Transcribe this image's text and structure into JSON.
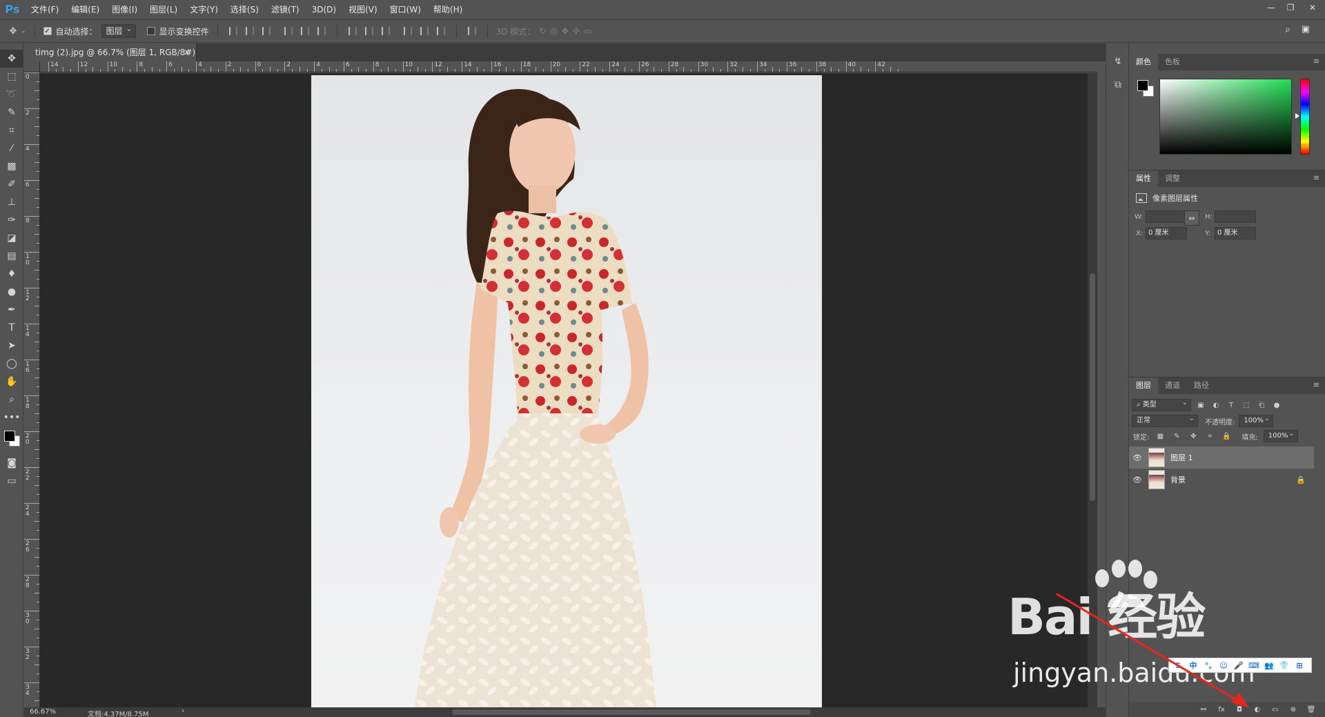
{
  "app": {
    "logo": "Ps"
  },
  "menu": [
    "文件(F)",
    "编辑(E)",
    "图像(I)",
    "图层(L)",
    "文字(Y)",
    "选择(S)",
    "滤镜(T)",
    "3D(D)",
    "视图(V)",
    "窗口(W)",
    "帮助(H)"
  ],
  "window_controls": [
    "—",
    "❐",
    "✕"
  ],
  "options": {
    "auto_select_label": "自动选择：",
    "auto_select_value": "图层",
    "show_transform_label": "显示变换控件",
    "mode_3d_label": "3D 模式："
  },
  "document": {
    "tab_title": "timg (2).jpg @ 66.7% (图层 1, RGB/8#) *",
    "close_glyph": "✕"
  },
  "rulers": {
    "top_labels": [
      "14",
      "12",
      "10",
      "8",
      "6",
      "4",
      "2",
      "0",
      "2",
      "4",
      "6",
      "8",
      "10",
      "12",
      "14",
      "16",
      "18",
      "20",
      "22",
      "24",
      "26",
      "28",
      "30",
      "32",
      "34",
      "36",
      "38",
      "40",
      "42"
    ],
    "left_labels": [
      "0",
      "2",
      "4",
      "6",
      "8",
      "10",
      "12",
      "14",
      "16",
      "18",
      "20",
      "22",
      "24",
      "26",
      "28",
      "30",
      "32",
      "34"
    ]
  },
  "status": {
    "zoom": "66.67%",
    "doc_size": "文档:4.37M/8.75M",
    "arrow": "›"
  },
  "color_panel": {
    "tabs": [
      "颜色",
      "色板"
    ],
    "active_tab": "颜色"
  },
  "properties_panel": {
    "tabs": [
      "属性",
      "调整"
    ],
    "header": "像素图层属性",
    "w_label": "W:",
    "h_label": "H:",
    "x_label": "X:",
    "x_value": "0 厘米",
    "y_label": "Y:",
    "y_value": "0 厘米",
    "link_glyph": "⇔"
  },
  "layers_panel": {
    "tabs": [
      "图层",
      "通道",
      "路径"
    ],
    "filter_value": "类型",
    "blend_mode": "正常",
    "opacity_label": "不透明度:",
    "opacity_value": "100%",
    "lock_label": "锁定:",
    "fill_label": "填充:",
    "fill_value": "100%",
    "layers": [
      {
        "name": "图层 1",
        "selected": true,
        "locked": false
      },
      {
        "name": "背景",
        "selected": false,
        "locked": true
      }
    ],
    "footer_fx": "fx"
  },
  "watermark": {
    "logo": "Bai  经验",
    "url": "jingyan.baidu.com"
  },
  "ime": {
    "items": [
      "S",
      "中",
      "°,",
      "☺",
      "🎤",
      "⌨",
      "👥",
      "👕",
      "⊞"
    ]
  },
  "colors": {
    "ui_bg": "#535353",
    "canvas_bg": "#282828",
    "accent": "#31a8ff",
    "arrow": "#e8241c"
  }
}
